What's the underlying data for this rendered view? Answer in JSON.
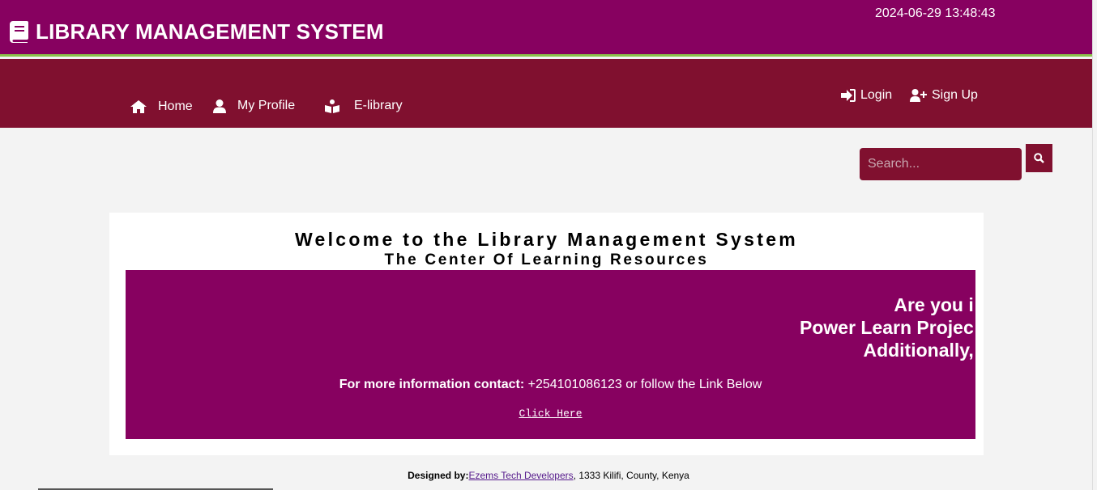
{
  "header": {
    "title": "LIBRARY MANAGEMENT SYSTEM",
    "brand_icon": "book-icon",
    "datetime": "2024-06-29 13:48:43"
  },
  "nav": {
    "items": [
      {
        "label": "Home",
        "icon": "home-icon"
      },
      {
        "label": "My Profile",
        "icon": "user-icon"
      },
      {
        "label": "E-library",
        "icon": "book-reader-icon"
      }
    ],
    "login_label": "Login",
    "signup_label": "Sign Up"
  },
  "search": {
    "placeholder": "Search..."
  },
  "main": {
    "welcome": "Welcome to the Library Management System",
    "subtitle": "The Center Of Learning Resources",
    "marquee_lines": [
      "Are you i",
      "Power Learn Projec",
      "Additionally,"
    ],
    "contact_label": "For more information contact:",
    "contact_text": " +254101086123 or follow the Link Below",
    "click_here": "Click Here"
  },
  "footer": {
    "designed_by_label": "Designed by:",
    "designer_link": "Ezems Tech Developers",
    "address": ", 1333 Kilifi, County, Kenya"
  },
  "colors": {
    "header_bg": "#870160",
    "nav_bg": "#80102f",
    "accent_line": "#8bc34a",
    "page_bg": "#f3f3f3"
  }
}
